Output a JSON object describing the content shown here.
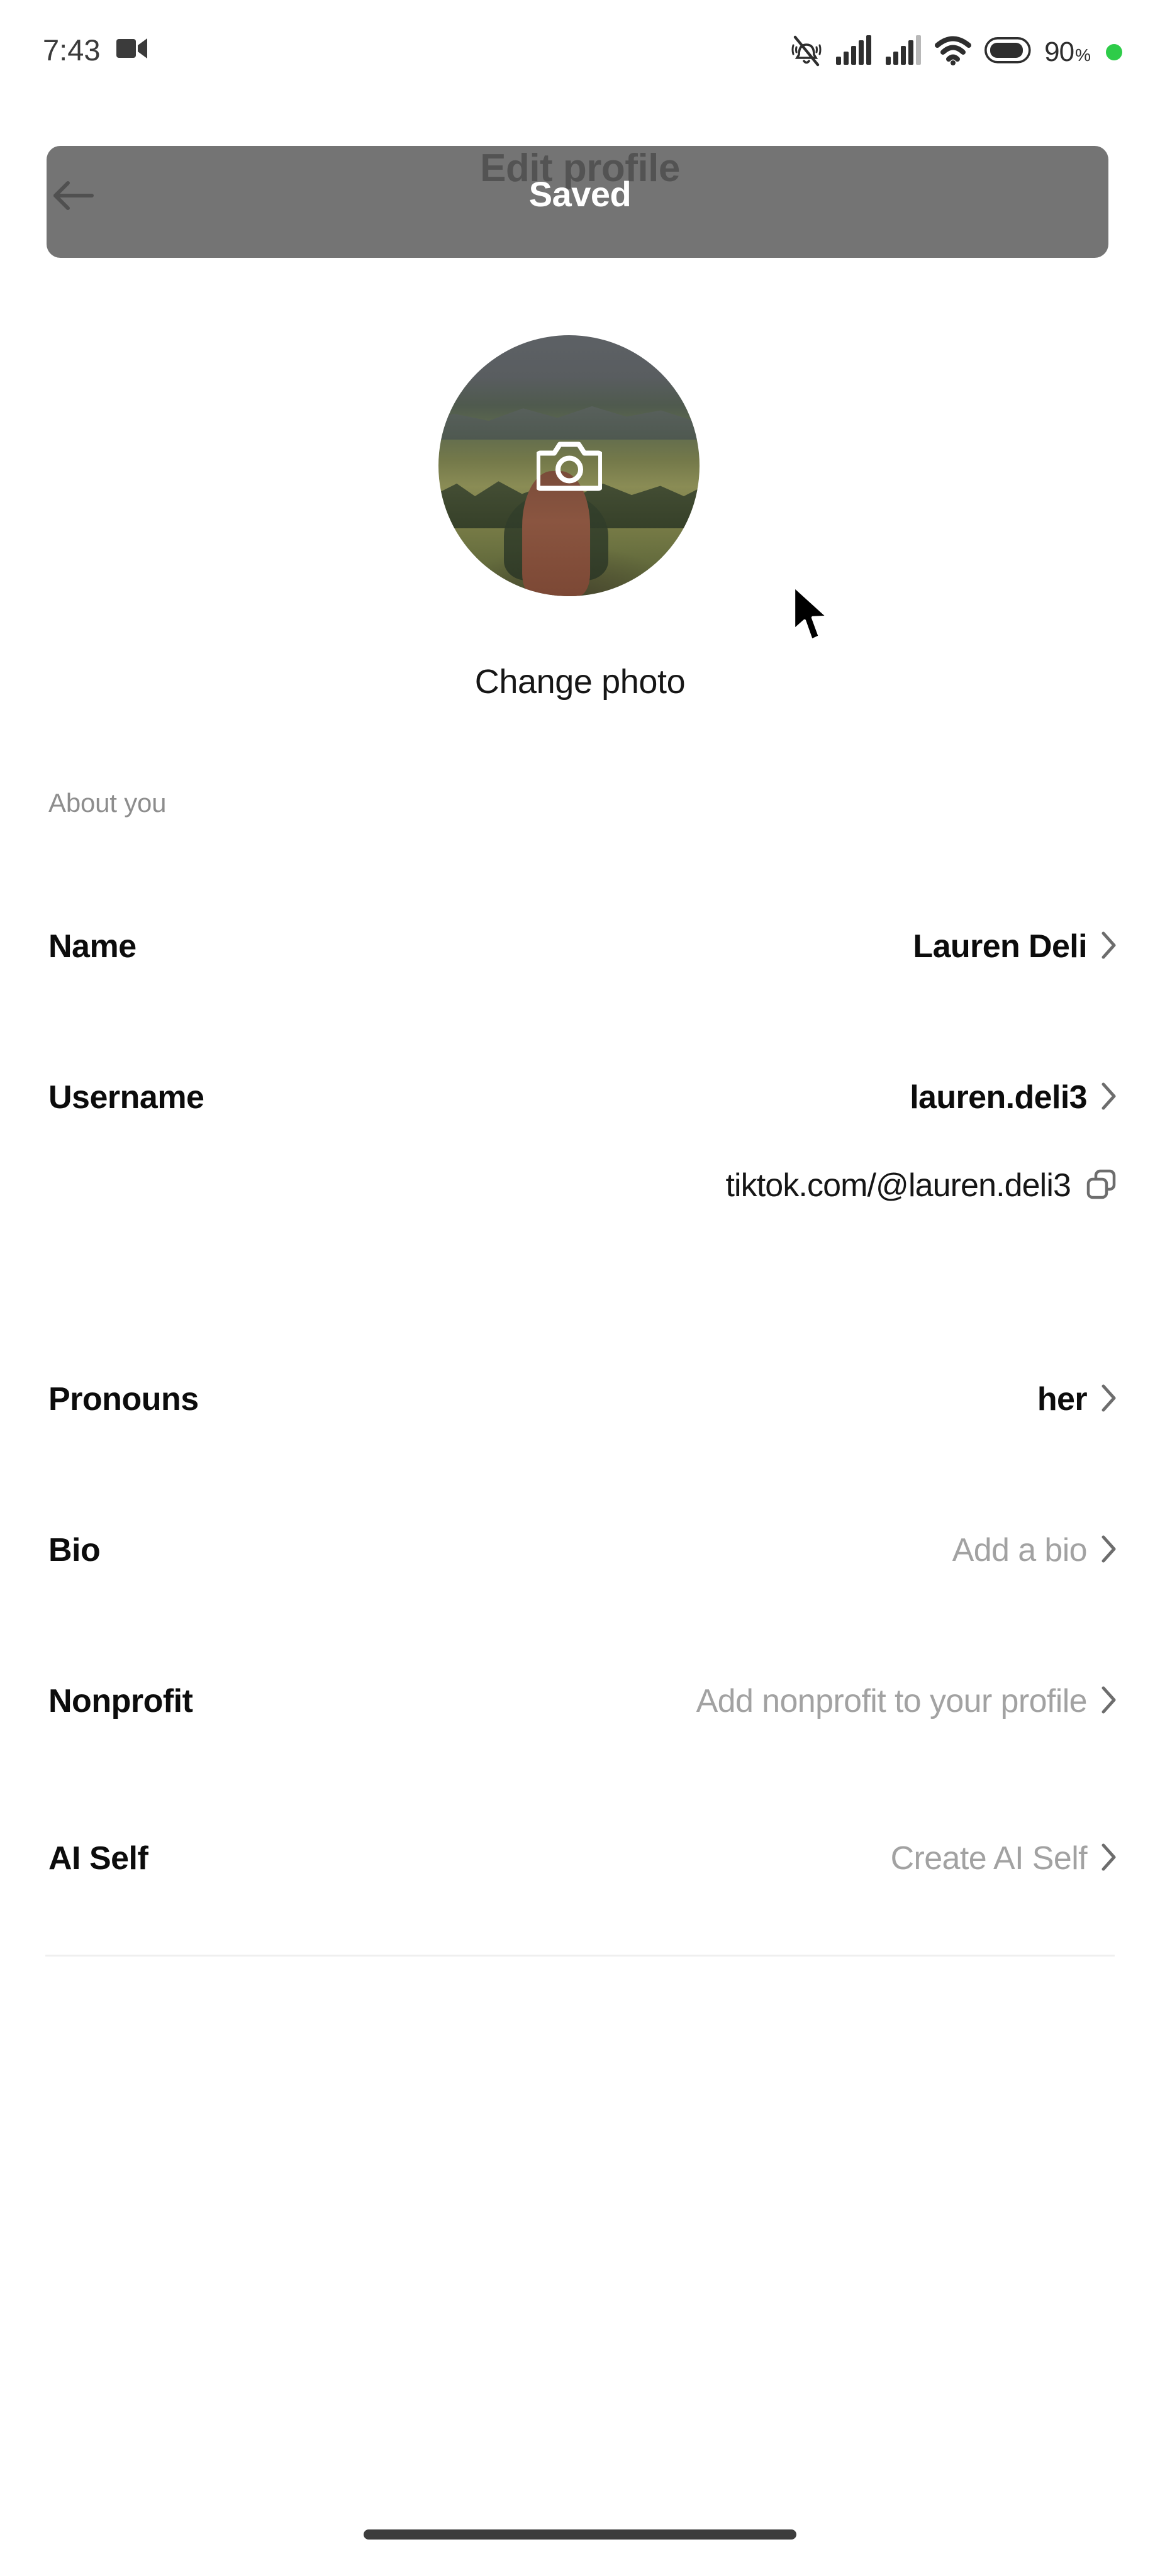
{
  "status_bar": {
    "time": "7:43",
    "video_icon": "video-camera-icon",
    "silent_icon": "bell-silent-icon",
    "signal_one_icon": "cellular-signal-icon",
    "signal_two_icon": "cellular-signal-icon",
    "wifi_icon": "wifi-icon",
    "battery_icon": "battery-icon",
    "battery_percent": "90",
    "percent_sign": "%",
    "recording_dot": "recording-indicator-dot",
    "accent_green": "#2ecc49"
  },
  "header": {
    "back_icon": "back-arrow-icon",
    "title": "Edit profile"
  },
  "toast": {
    "message": "Saved",
    "background": "#565656",
    "text_color": "#ffffff"
  },
  "avatar": {
    "camera_icon": "camera-icon",
    "change_photo_label": "Change photo"
  },
  "sections": {
    "about_label": "About you"
  },
  "rows": [
    {
      "label": "Name",
      "value": "Lauren Deli",
      "state": "filled",
      "chevron_icon": "chevron-right-icon"
    },
    {
      "label": "Username",
      "value": "lauren.deli3",
      "state": "filled",
      "chevron_icon": "chevron-right-icon"
    },
    {
      "label": "Pronouns",
      "value": "her",
      "state": "filled",
      "chevron_icon": "chevron-right-icon"
    },
    {
      "label": "Bio",
      "value": "Add a bio",
      "state": "placeholder",
      "chevron_icon": "chevron-right-icon"
    },
    {
      "label": "Nonprofit",
      "value": "Add nonprofit to your profile",
      "state": "placeholder",
      "chevron_icon": "chevron-right-icon"
    },
    {
      "label": "AI Self",
      "value": "Create AI Self",
      "state": "placeholder",
      "chevron_icon": "chevron-right-icon"
    }
  ],
  "profile_url": {
    "text": "tiktok.com/@lauren.deli3",
    "copy_icon": "copy-icon"
  },
  "cursor": {
    "icon": "mouse-pointer-icon"
  },
  "navigation": {
    "home_indicator": "home-indicator-bar"
  }
}
